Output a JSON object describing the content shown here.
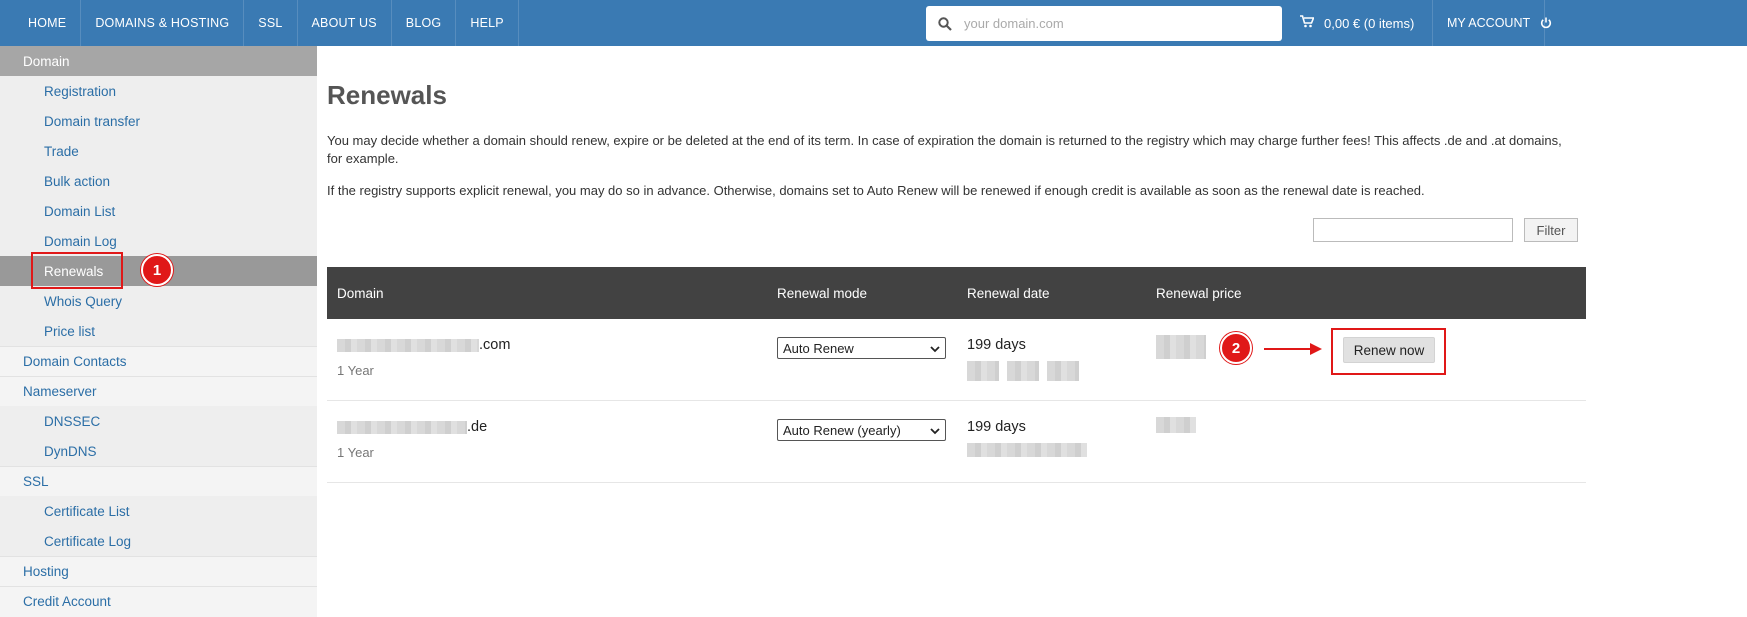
{
  "nav": {
    "items": [
      "HOME",
      "DOMAINS & HOSTING",
      "SSL",
      "ABOUT US",
      "BLOG",
      "HELP"
    ],
    "search_placeholder": "your domain.com",
    "cart": "0,00 € (0 items)",
    "my_account": "MY ACCOUNT"
  },
  "sidebar": {
    "items": [
      {
        "label": "Domain",
        "level": 0,
        "state": "header"
      },
      {
        "label": "Registration",
        "level": 1
      },
      {
        "label": "Domain transfer",
        "level": 1
      },
      {
        "label": "Trade",
        "level": 1
      },
      {
        "label": "Bulk action",
        "level": 1
      },
      {
        "label": "Domain List",
        "level": 1
      },
      {
        "label": "Domain Log",
        "level": 1
      },
      {
        "label": "Renewals",
        "level": 1,
        "state": "active"
      },
      {
        "label": "Whois Query",
        "level": 1
      },
      {
        "label": "Price list",
        "level": 1
      },
      {
        "label": "Domain Contacts",
        "level": 0
      },
      {
        "label": "Nameserver",
        "level": 0
      },
      {
        "label": "DNSSEC",
        "level": 1
      },
      {
        "label": "DynDNS",
        "level": 1
      },
      {
        "label": "SSL",
        "level": 0
      },
      {
        "label": "Certificate List",
        "level": 1
      },
      {
        "label": "Certificate Log",
        "level": 1
      },
      {
        "label": "Hosting",
        "level": 0
      },
      {
        "label": "Credit Account",
        "level": 0
      }
    ]
  },
  "main": {
    "title": "Renewals",
    "paragraph1": "You may decide whether a domain should renew, expire or be deleted at the end of its term. In case of expiration the domain is returned to the registry which may charge further fees! This affects .de and .at domains, for example.",
    "paragraph2": "If the registry supports explicit renewal, you may do so in advance. Otherwise, domains set to Auto Renew will be renewed if enough credit is available as soon as the renewal date is reached.",
    "filter_button": "Filter",
    "table": {
      "headers": [
        "Domain",
        "Renewal mode",
        "Renewal date",
        "Renewal price"
      ],
      "rows": [
        {
          "domain_suffix": ".com",
          "term": "1 Year",
          "mode": "Auto Renew",
          "days": "199 days",
          "action": "Renew now"
        },
        {
          "domain_suffix": ".de",
          "term": "1 Year",
          "mode": "Auto Renew (yearly)",
          "days": "199 days",
          "action": ""
        }
      ]
    }
  },
  "annotations": {
    "badge1": "1",
    "badge2": "2"
  }
}
